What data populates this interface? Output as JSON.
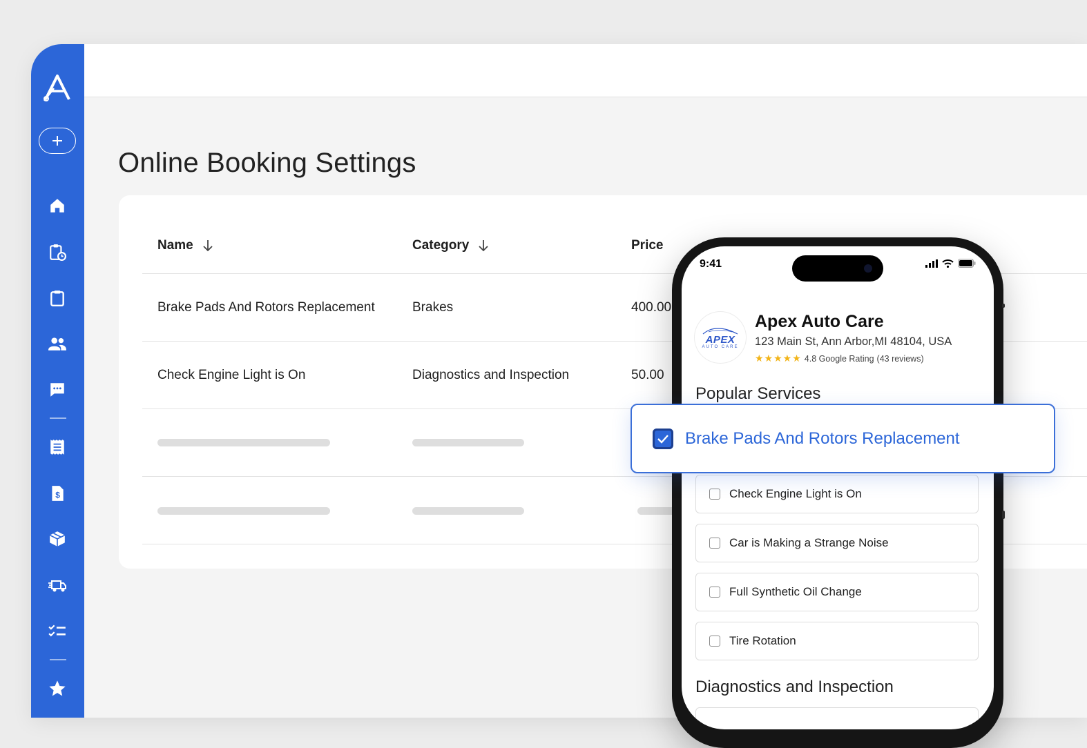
{
  "app": {
    "page_title": "Online Booking Settings"
  },
  "sidebar": {
    "add_label": "+",
    "items": [
      {
        "icon": "home-icon"
      },
      {
        "icon": "calendar-clipboard-icon"
      },
      {
        "icon": "clipboard-icon"
      },
      {
        "icon": "people-icon"
      },
      {
        "icon": "chat-icon"
      },
      {
        "icon": "list-icon"
      },
      {
        "icon": "invoice-icon"
      },
      {
        "icon": "package-icon"
      },
      {
        "icon": "truck-icon"
      },
      {
        "icon": "checklist-icon"
      },
      {
        "icon": "star-icon"
      }
    ]
  },
  "table": {
    "columns": [
      "Name",
      "Category",
      "Price"
    ],
    "rows": [
      {
        "name": "Brake Pads And Rotors Replacement",
        "category": "Brakes",
        "price": "400.00"
      },
      {
        "name": "Check Engine Light is On",
        "category": "Diagnostics and Inspection",
        "price": "50.00"
      }
    ]
  },
  "phone": {
    "time": "9:41",
    "shop": {
      "logo_text": "APEX",
      "logo_sub": "AUTO CARE",
      "name": "Apex Auto Care",
      "address": "123 Main St, Ann Arbor,MI 48104, USA",
      "stars": "★★★★★",
      "rating": "4.8 Google Rating",
      "reviews": "(43 reviews)"
    },
    "popular_title": "Popular Services",
    "selected_service": "Brake Pads And Rotors Replacement",
    "services": [
      "Check Engine Light is On",
      "Car is Making a Strange Noise",
      "Full Synthetic Oil Change",
      "Tire Rotation"
    ],
    "diagnostics_title": "Diagnostics and Inspection"
  },
  "colors": {
    "brand": "#2c66d8",
    "star": "#f2b418"
  }
}
